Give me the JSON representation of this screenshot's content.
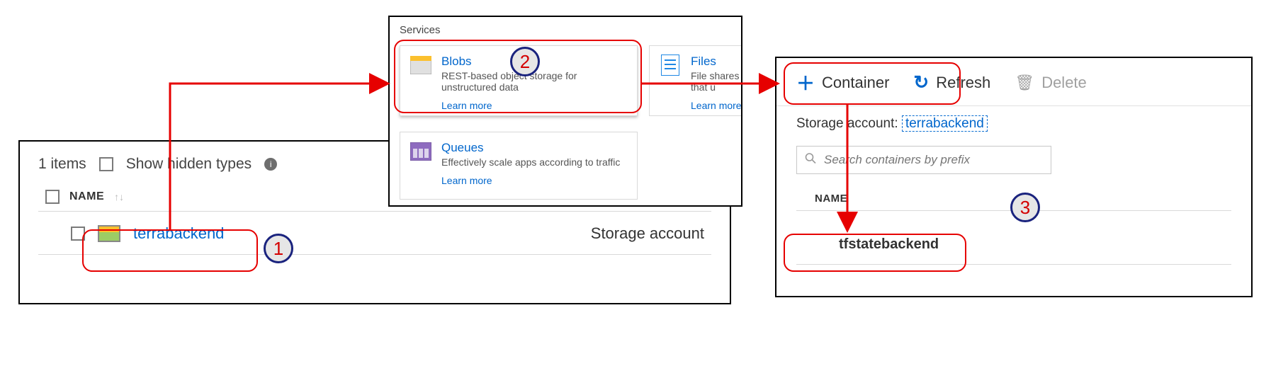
{
  "annotations": {
    "step1": "1",
    "step2": "2",
    "step3": "3"
  },
  "panel1": {
    "items_count_label": "1 items",
    "show_hidden_label": "Show hidden types",
    "col_name": "NAME",
    "row": {
      "name": "terrabackend",
      "type": "Storage account"
    }
  },
  "panel2": {
    "header": "Services",
    "blobs": {
      "title": "Blobs",
      "desc": "REST-based object storage for unstructured data",
      "learn": "Learn more"
    },
    "files": {
      "title": "Files",
      "desc": "File shares that u",
      "learn": "Learn more"
    },
    "queues": {
      "title": "Queues",
      "desc": "Effectively scale apps according to traffic",
      "learn": "Learn more"
    }
  },
  "panel3": {
    "toolbar": {
      "container": "Container",
      "refresh": "Refresh",
      "delete": "Delete"
    },
    "storage_account_label": "Storage account:",
    "storage_account_value": "terrabackend",
    "search_placeholder": "Search containers by prefix",
    "col_name": "NAME",
    "row_name": "tfstatebackend"
  }
}
